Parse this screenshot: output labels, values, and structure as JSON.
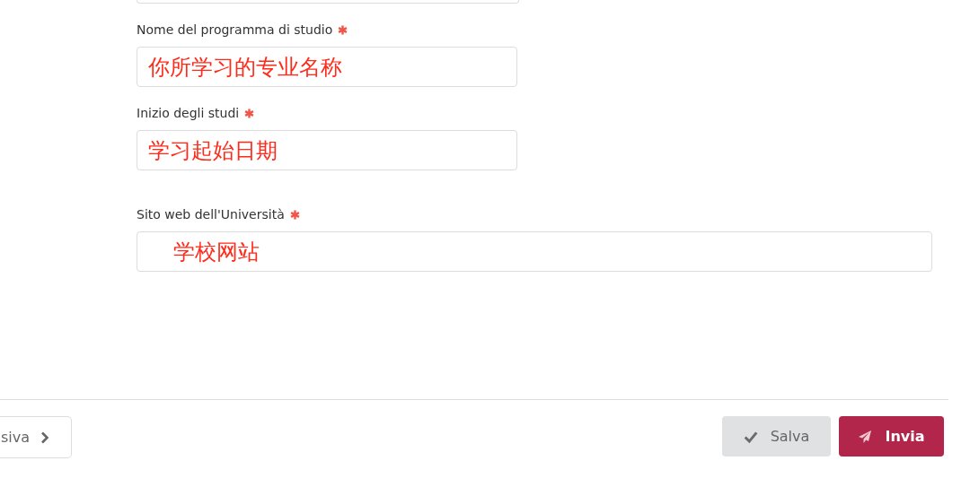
{
  "fields": [
    {
      "label": "Nome del programma di studio",
      "required": true,
      "value": "你所学习的专业名称",
      "wide": false
    },
    {
      "label": "Inizio degli studi",
      "required": true,
      "value": "学习起始日期",
      "wide": false
    },
    {
      "label": "Sito web dell'Università",
      "required": true,
      "value": "学校网站",
      "wide": true
    }
  ],
  "footer": {
    "next_button": "siva",
    "save_button": "Salva",
    "submit_button": "Invia"
  }
}
